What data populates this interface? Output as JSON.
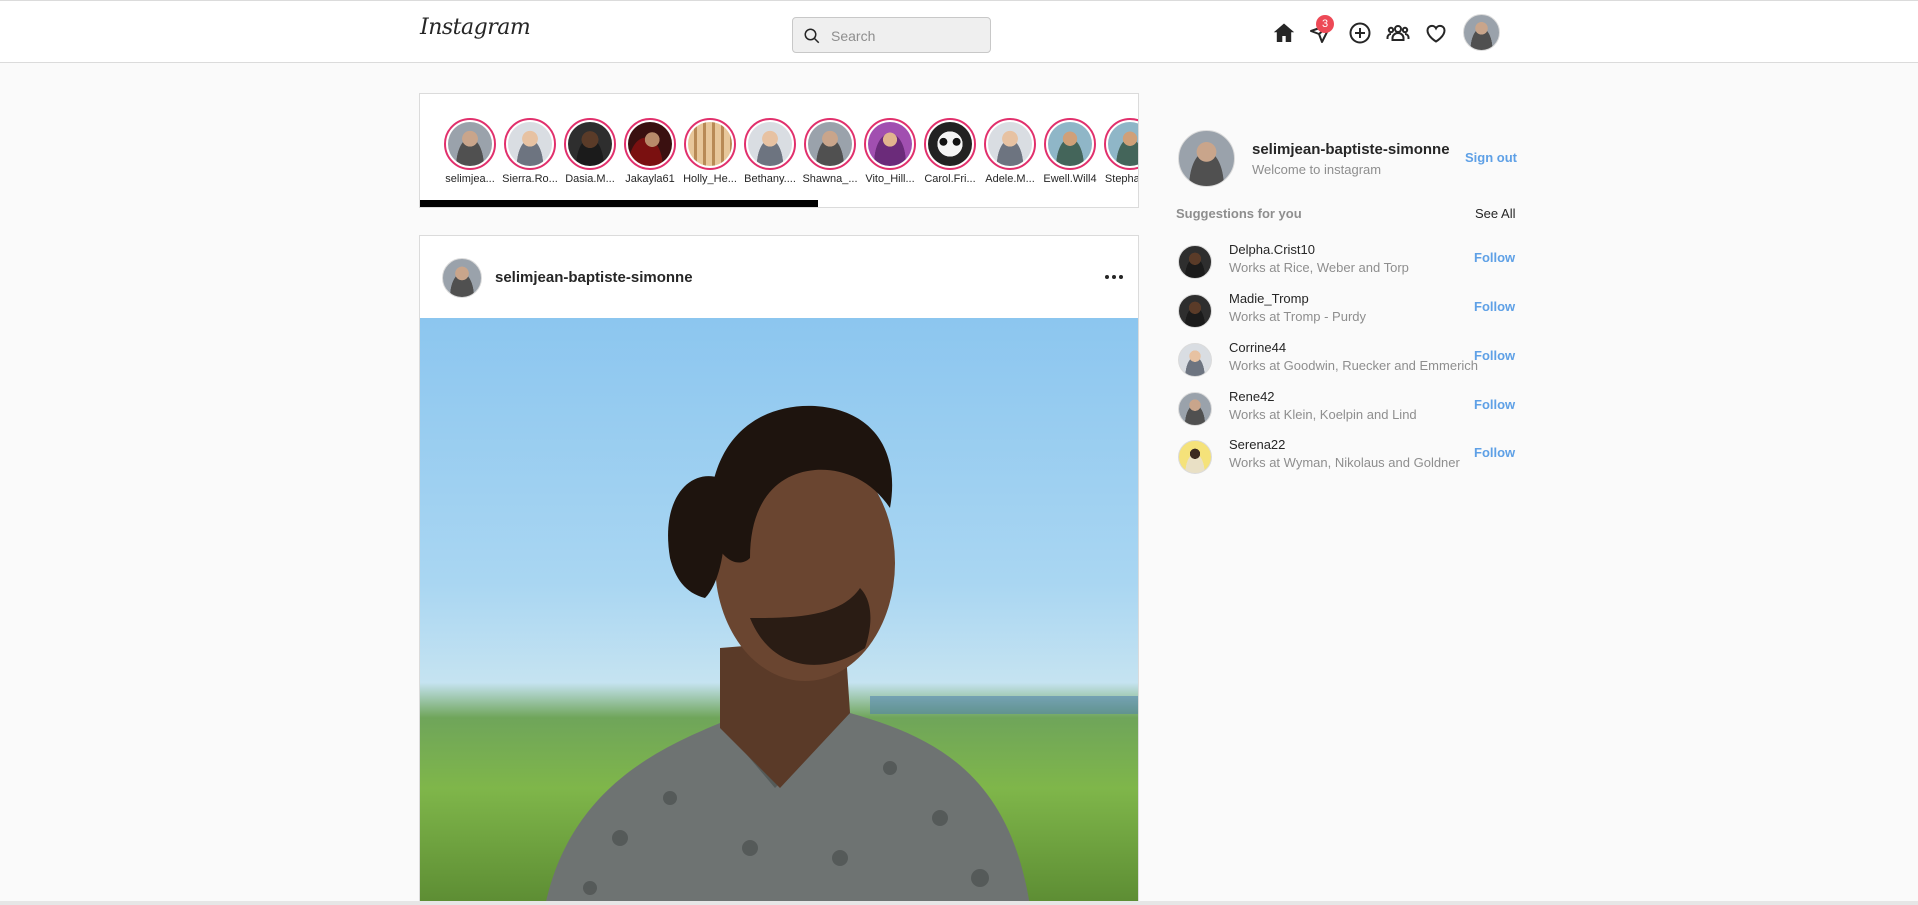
{
  "header": {
    "logo": "Instagram",
    "search_placeholder": "Search",
    "messages_badge": "3",
    "icons": [
      "home-icon",
      "send-icon",
      "add-post-icon",
      "explore-people-icon",
      "heart-icon"
    ]
  },
  "stories": [
    {
      "username": "selimjea...",
      "style": "grey"
    },
    {
      "username": "Sierra.Ro...",
      "style": "light"
    },
    {
      "username": "Dasia.M...",
      "style": "dark"
    },
    {
      "username": "Jakayla61",
      "style": "red"
    },
    {
      "username": "Holly_He...",
      "style": "food"
    },
    {
      "username": "Bethany....",
      "style": "light"
    },
    {
      "username": "Shawna_...",
      "style": "grey"
    },
    {
      "username": "Vito_Hill...",
      "style": "purple"
    },
    {
      "username": "Carol.Fri...",
      "style": "panda"
    },
    {
      "username": "Adele.M...",
      "style": "light"
    },
    {
      "username": "Ewell.Will4",
      "style": "green"
    },
    {
      "username": "Stephan...",
      "style": "green"
    }
  ],
  "post": {
    "username": "selimjean-baptiste-simonne"
  },
  "sidebar": {
    "username": "selimjean-baptiste-simonne",
    "subtitle": "Welcome to instagram",
    "signout": "Sign out",
    "suggestions_title": "Suggestions for you",
    "see_all": "See All",
    "follow_label": "Follow",
    "suggestions": [
      {
        "name": "Delpha.Crist10",
        "work": "Works at Rice, Weber and Torp",
        "style": "dark"
      },
      {
        "name": "Madie_Tromp",
        "work": "Works at Tromp - Purdy",
        "style": "dark"
      },
      {
        "name": "Corrine44",
        "work": "Works at Goodwin, Ruecker and Emmerich",
        "style": "light"
      },
      {
        "name": "Rene42",
        "work": "Works at Klein, Koelpin and Lind",
        "style": "grey"
      },
      {
        "name": "Serena22",
        "work": "Works at Wyman, Nikolaus and Goldner",
        "style": "yellow"
      }
    ]
  },
  "colors": {
    "link": "#5ea0e6",
    "badge": "#ed4956",
    "story_ring": "#e1306c"
  }
}
